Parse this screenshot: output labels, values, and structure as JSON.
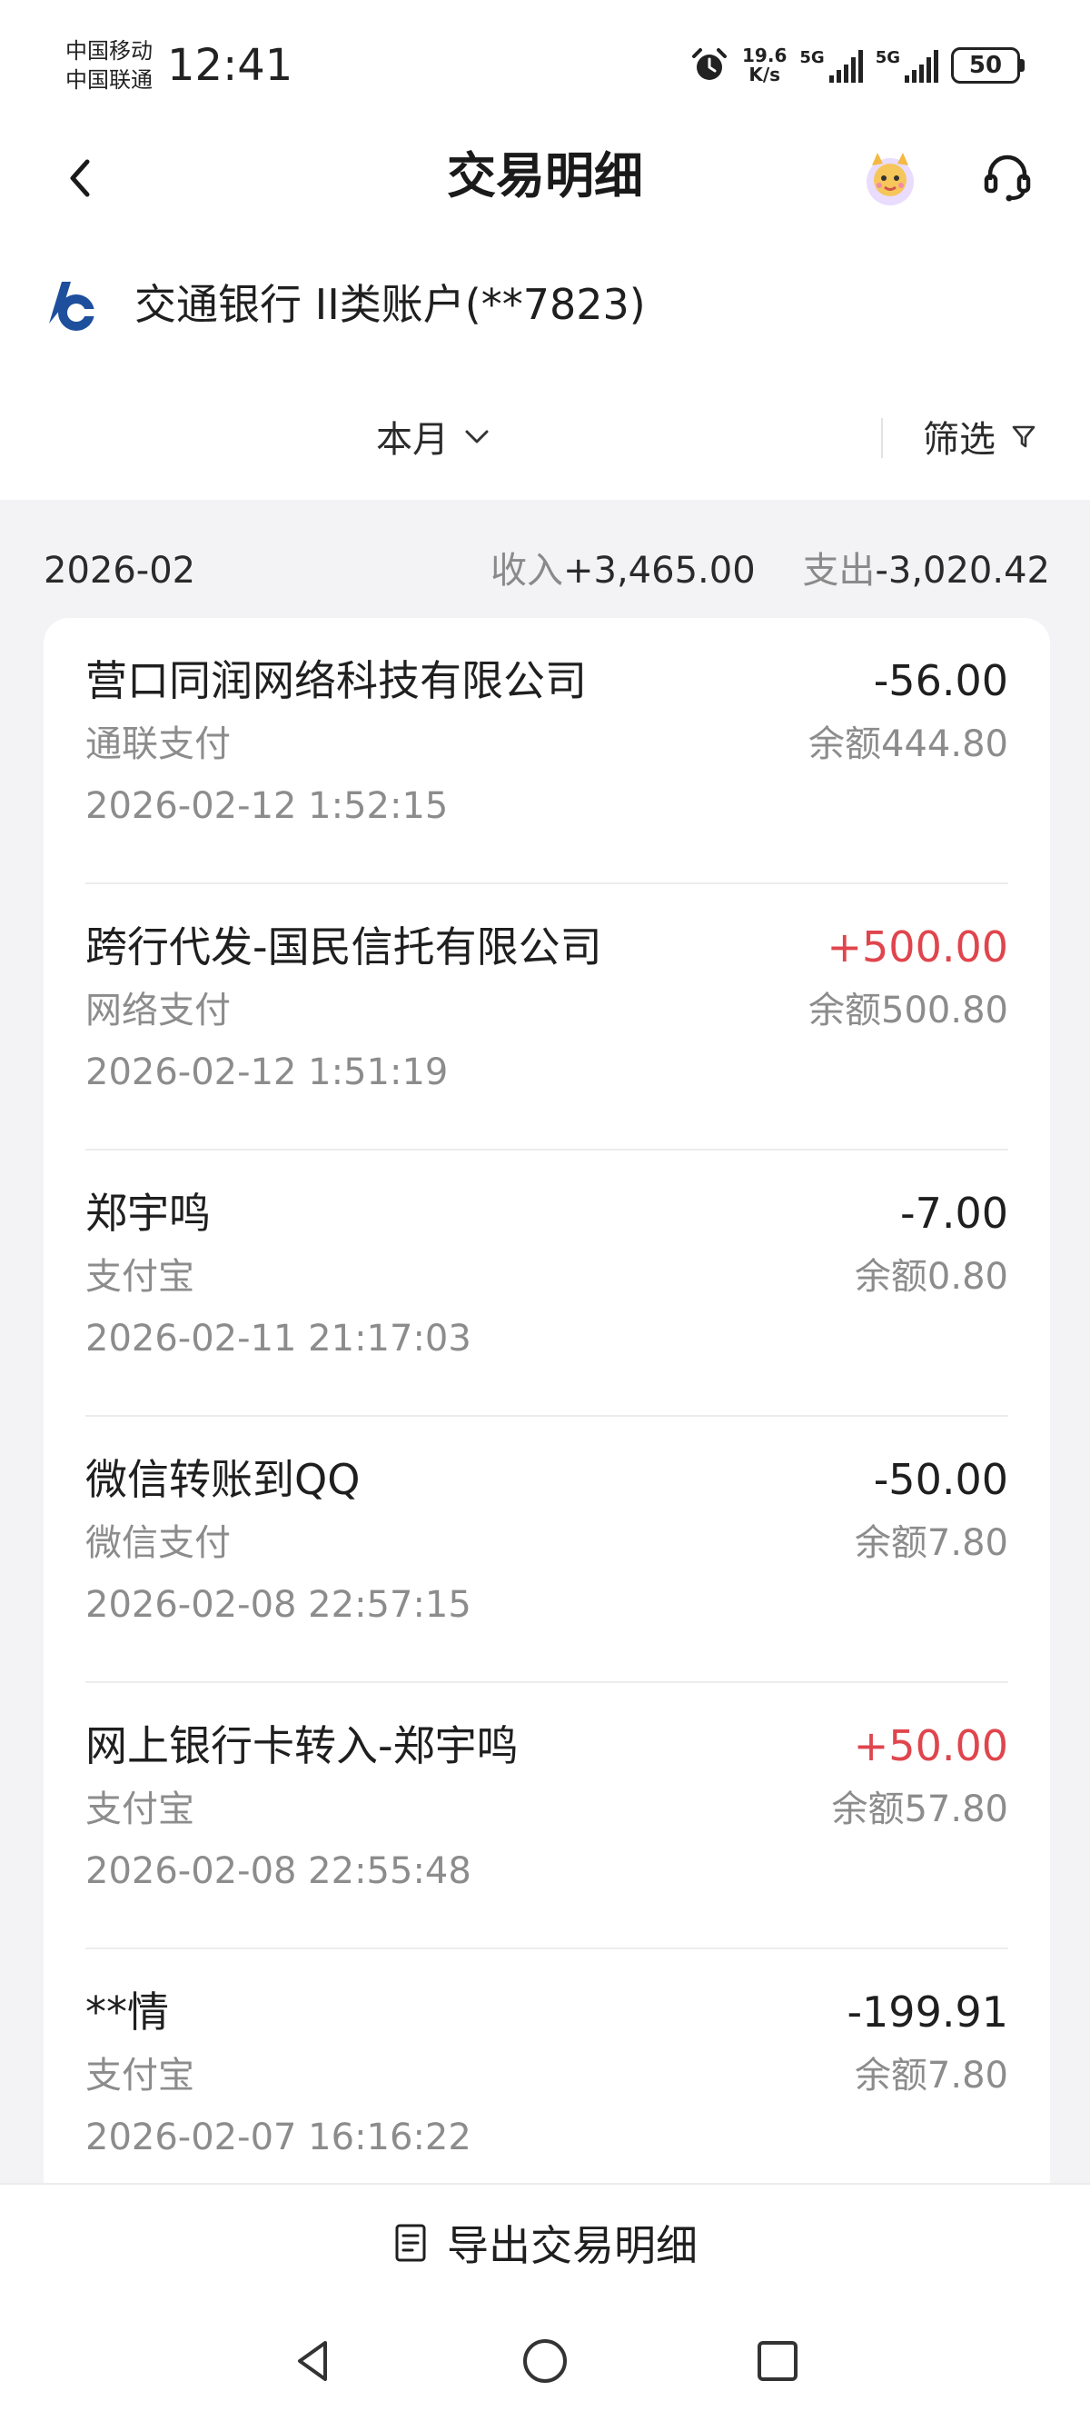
{
  "status_bar": {
    "carrier_1": "中国移动",
    "carrier_2": "中国联通",
    "time": "12:41",
    "net_speed_value": "19.6",
    "net_speed_unit": "K/s",
    "signal_1_label": "5G",
    "signal_2_label": "5G",
    "battery": "50",
    "icons": [
      "alarm-icon",
      "signal-icon",
      "battery-icon"
    ]
  },
  "header": {
    "title": "交易明细",
    "icons": [
      "back-icon",
      "mascot-icon",
      "headset-icon"
    ]
  },
  "account": {
    "name": "交通银行 II类账户(**7823)",
    "logo_color": "#1d4f9c"
  },
  "filters": {
    "period": "本月",
    "filter_label": "筛选"
  },
  "summary": {
    "month": "2026-02",
    "income_label": "收入",
    "income_value": "+3,465.00",
    "expense_label": "支出",
    "expense_value": "-3,020.42"
  },
  "transactions": [
    {
      "name": "营口同润网络科技有限公司",
      "amount": "-56.00",
      "channel": "通联支付",
      "balance": "余额444.80",
      "time": "2026-02-12 1:52:15"
    },
    {
      "name": "跨行代发-国民信托有限公司",
      "amount": "+500.00",
      "channel": "网络支付",
      "balance": "余额500.80",
      "time": "2026-02-12 1:51:19"
    },
    {
      "name": "郑宇鸣",
      "amount": "-7.00",
      "channel": "支付宝",
      "balance": "余额0.80",
      "time": "2026-02-11 21:17:03"
    },
    {
      "name": "微信转账到QQ",
      "amount": "-50.00",
      "channel": "微信支付",
      "balance": "余额7.80",
      "time": "2026-02-08 22:57:15"
    },
    {
      "name": "网上银行卡转入-郑宇鸣",
      "amount": "+50.00",
      "channel": "支付宝",
      "balance": "余额57.80",
      "time": "2026-02-08 22:55:48"
    },
    {
      "name": "**情",
      "amount": "-199.91",
      "channel": "支付宝",
      "balance": "余额7.80",
      "time": "2026-02-07 16:16:22"
    }
  ],
  "footer": {
    "export_label": "导出交易明细"
  },
  "colors": {
    "positive": "#e0454d",
    "muted": "#8c8c8c",
    "background_gray": "#f3f3f5"
  }
}
